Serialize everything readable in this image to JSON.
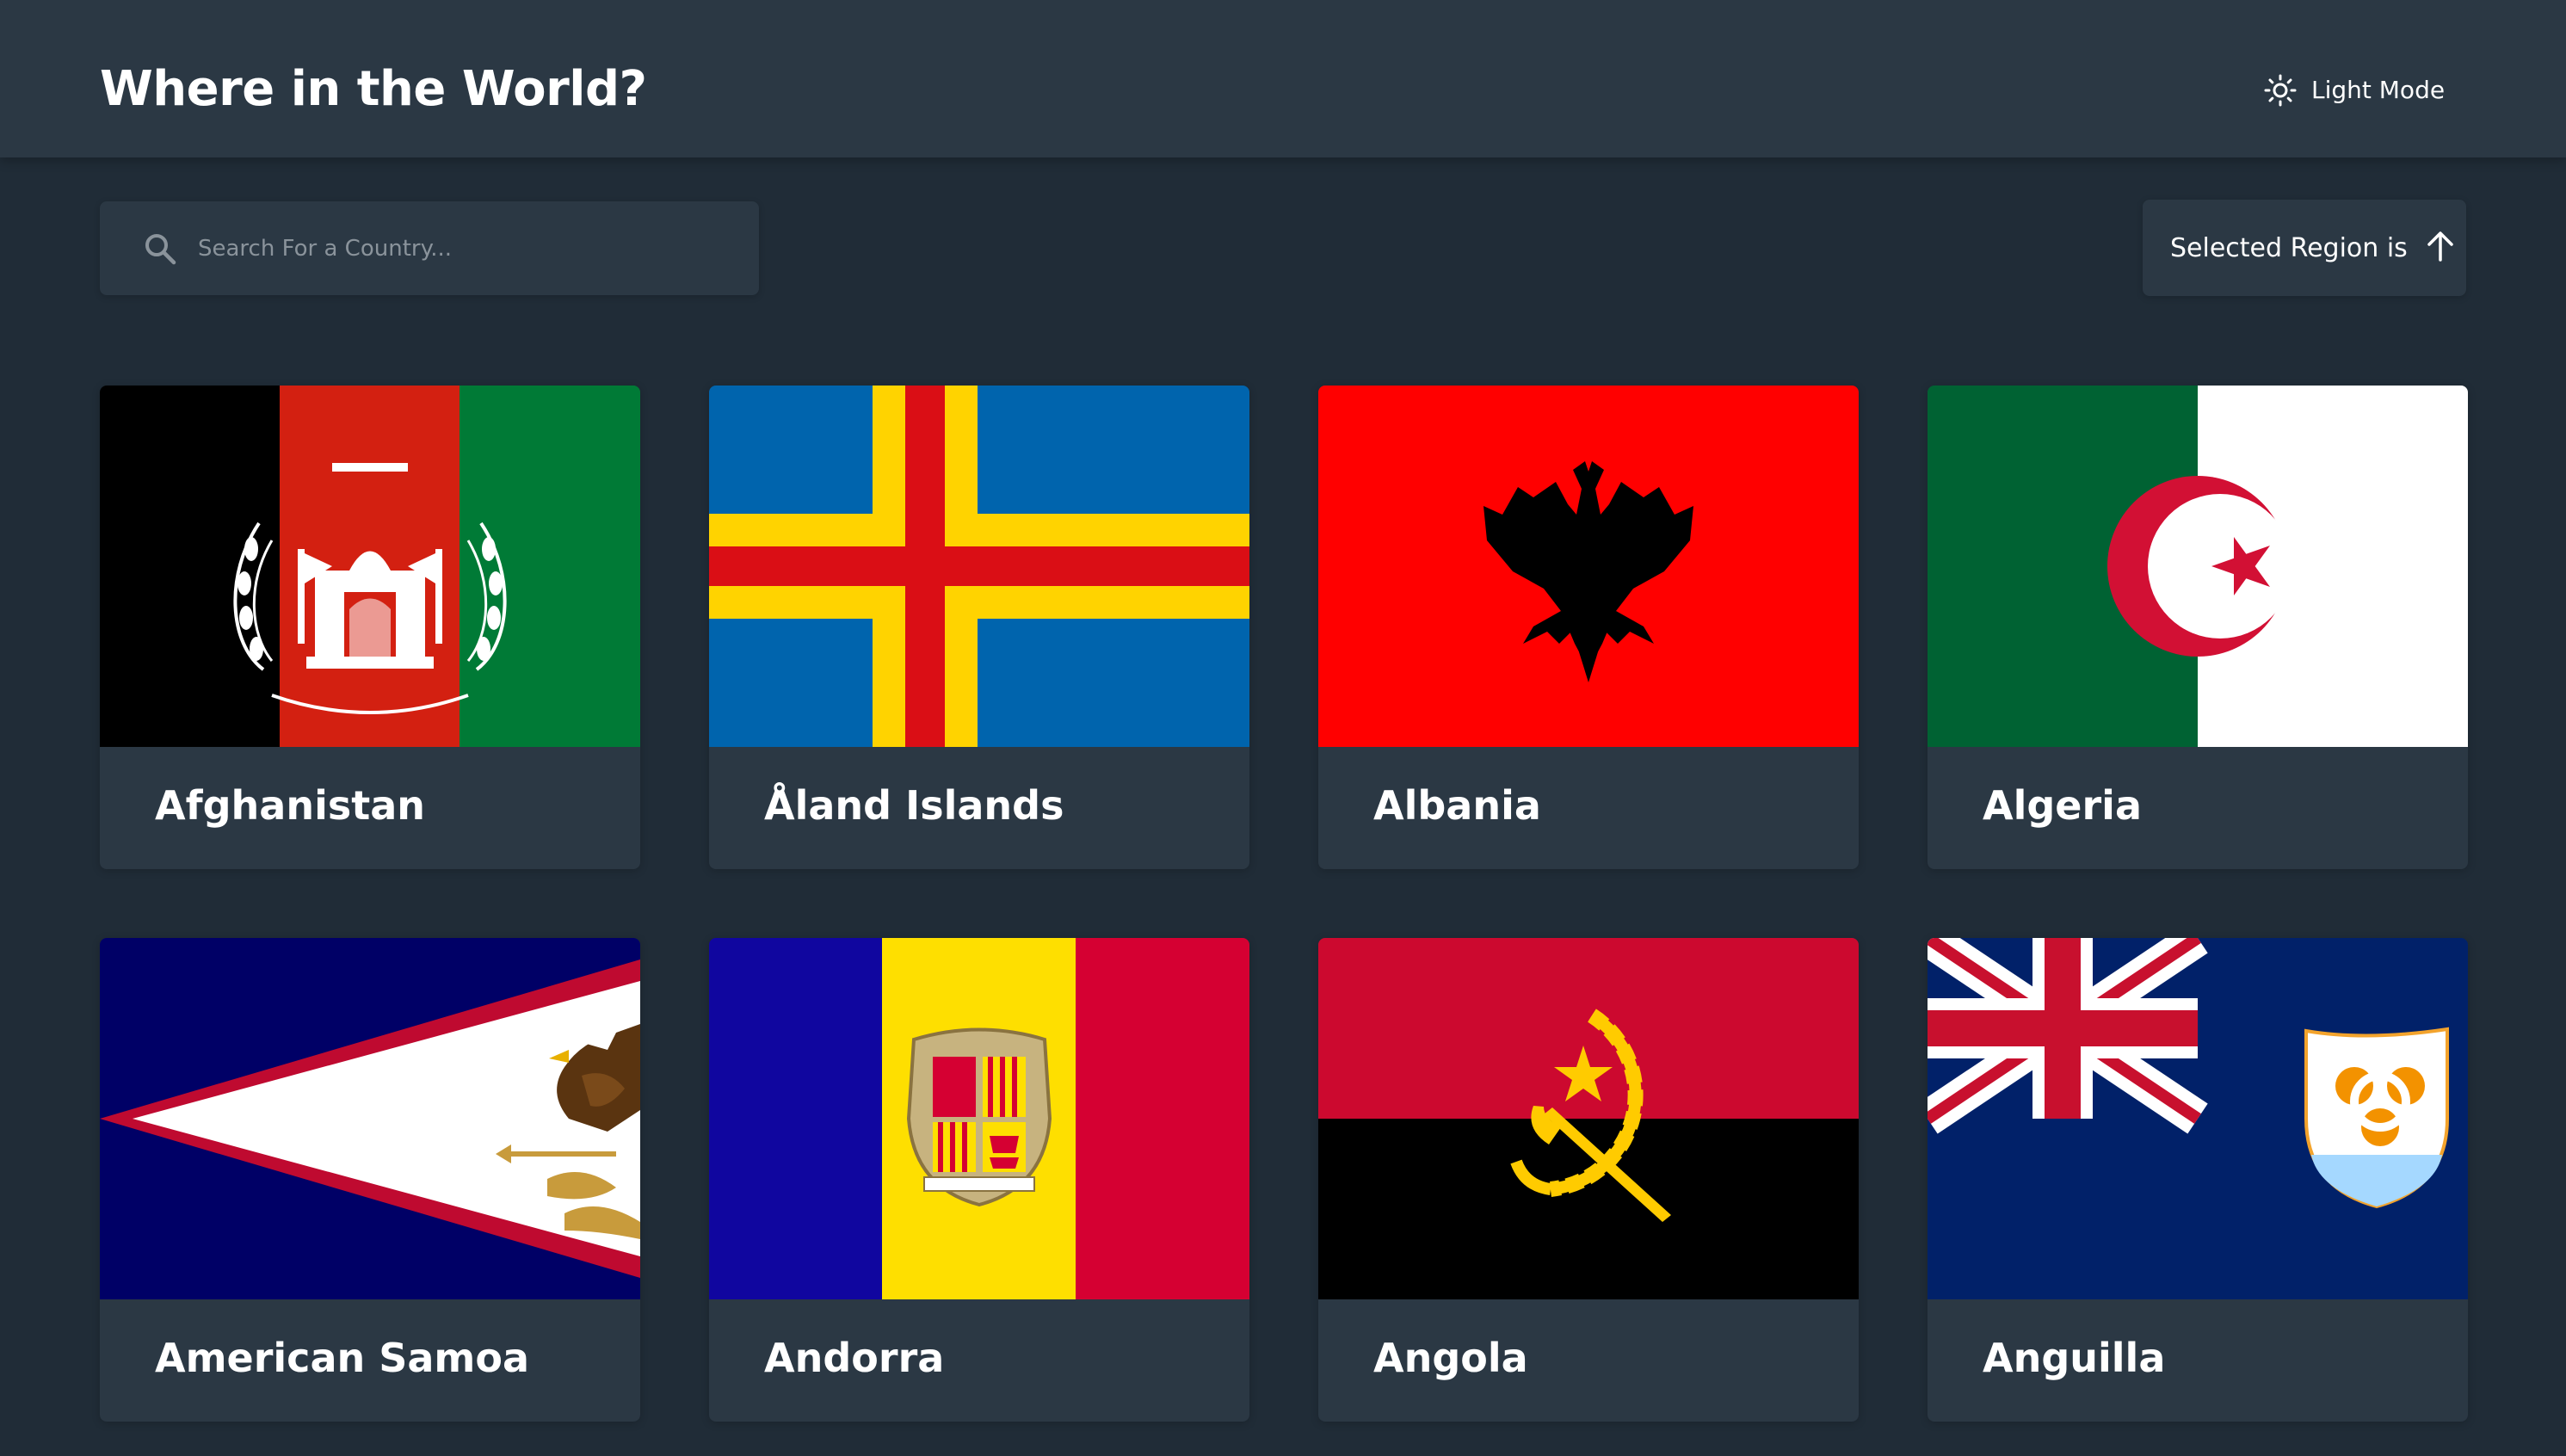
{
  "header": {
    "title": "Where in the World?",
    "theme_toggle_label": "Light Mode",
    "theme_icon": "sun-icon"
  },
  "search": {
    "placeholder": "Search For a Country...",
    "value": "",
    "icon": "search-icon"
  },
  "region_filter": {
    "label": "Selected Region is",
    "icon": "arrow-up-icon"
  },
  "colors": {
    "background": "#202c37",
    "element": "#2b3844",
    "text": "#ffffff",
    "placeholder": "#8a939b"
  },
  "countries": [
    {
      "name": "Afghanistan"
    },
    {
      "name": "Åland Islands"
    },
    {
      "name": "Albania"
    },
    {
      "name": "Algeria"
    },
    {
      "name": "American Samoa"
    },
    {
      "name": "Andorra"
    },
    {
      "name": "Angola"
    },
    {
      "name": "Anguilla"
    }
  ]
}
